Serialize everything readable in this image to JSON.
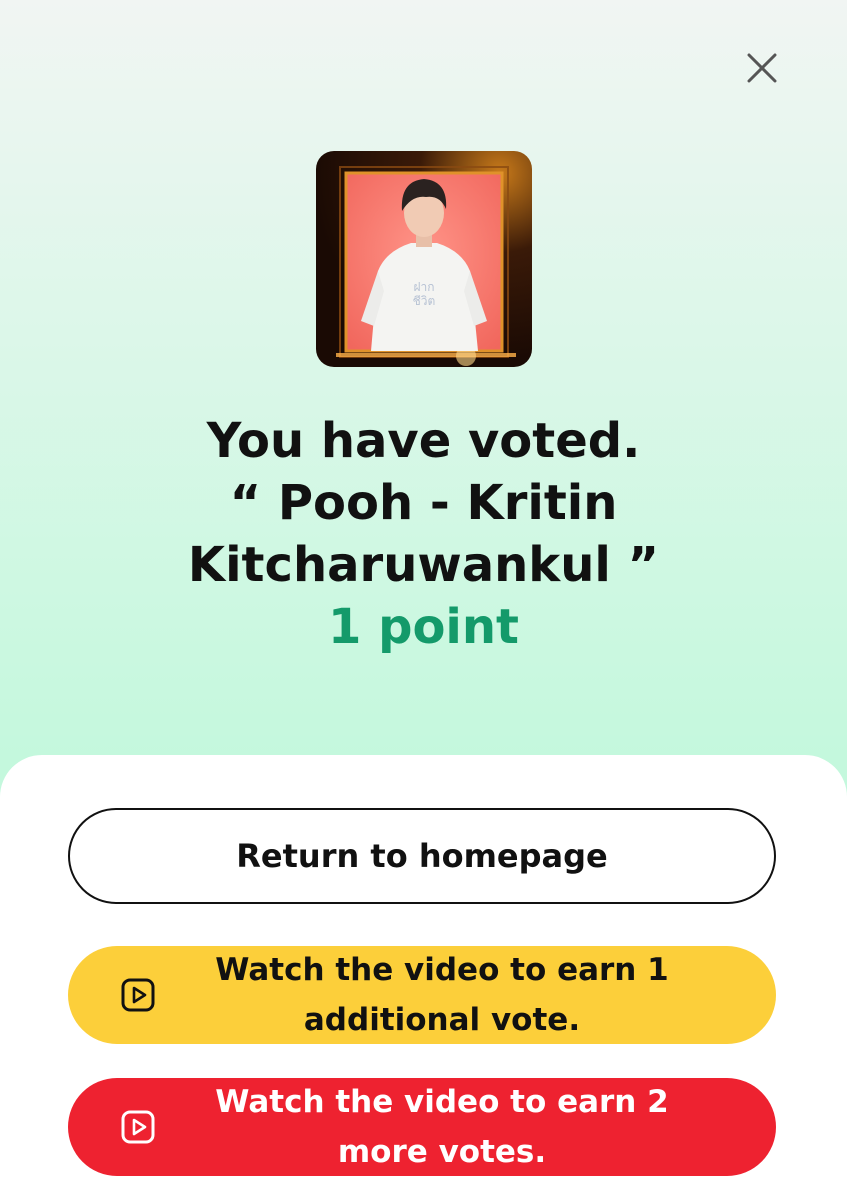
{
  "dialog": {
    "close_icon": "close-icon",
    "headline_line1": "You have voted.",
    "headline_line2": "“ Pooh - Kritin",
    "headline_line3": "Kitcharuwankul ”",
    "points": "1 point"
  },
  "actions": {
    "home_label": "Return to homepage",
    "watch_one_label": "Watch the video to earn 1 additional vote.",
    "watch_two_label": "Watch the video to earn 2 more votes.",
    "video_icon": "play-video-icon"
  },
  "colors": {
    "points_green": "#149a6a",
    "yellow_button": "#fccf3a",
    "red_button": "#ee2230"
  }
}
